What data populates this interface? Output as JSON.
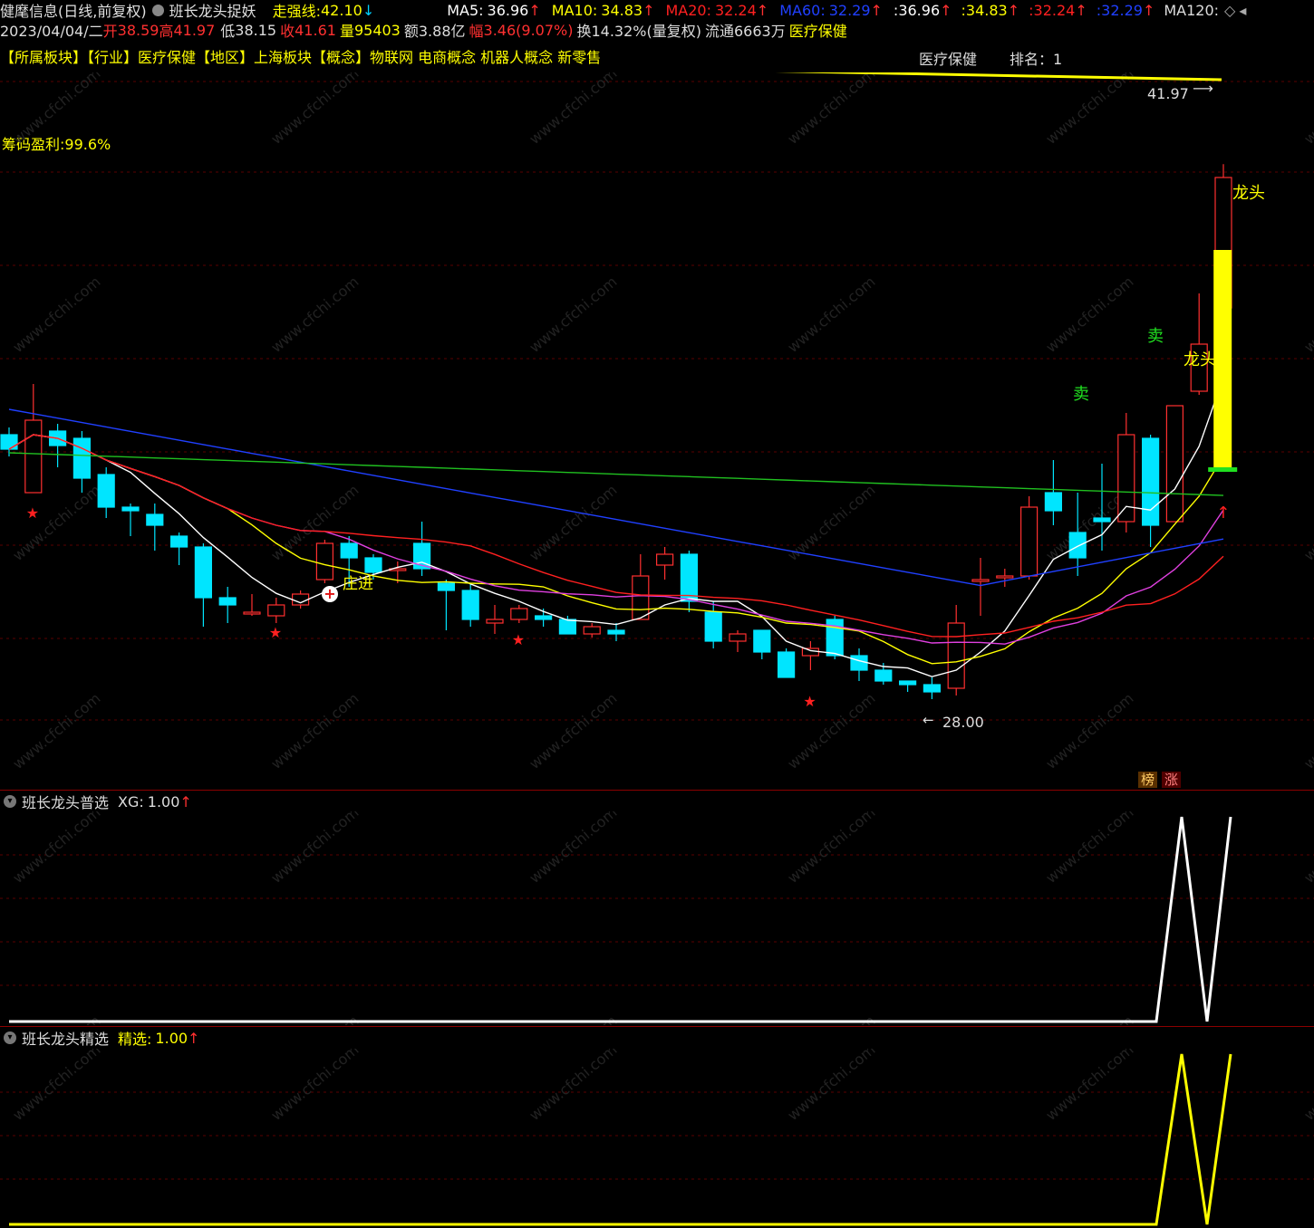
{
  "header": {
    "app_name": "健麾信息(日线,前复权)",
    "formula_name": "班长龙头捉妖",
    "strong_line_label": "走强线:",
    "strong_line_value": "42.10",
    "ma5_label": "MA5:",
    "ma5_value": "36.96",
    "ma10_label": "MA10:",
    "ma10_value": "34.83",
    "ma20_label": "MA20:",
    "ma20_value": "32.24",
    "ma60_label": "MA60:",
    "ma60_value": "32.29",
    "ma_repeat_1": ":36.96",
    "ma_repeat_2": ":34.83",
    "ma_repeat_3": ":32.24",
    "ma_repeat_4": ":32.29",
    "ma120_label": "MA120:",
    "colors": {
      "ma5": "#ffffff",
      "ma10": "#ffff00",
      "ma20": "#ff2020",
      "ma60": "#2040ff",
      "ma120": "#20c020"
    }
  },
  "quote": {
    "date": "2023/04/04/二",
    "open_label": "开",
    "open": "38.59",
    "high_label": "高",
    "high": "41.97",
    "low_label": "低",
    "low": "38.15",
    "close_label": "收",
    "close": "41.61",
    "volume_label": "量",
    "volume": "95403",
    "amount_label": "额",
    "amount": "3.88亿",
    "change_label": "幅",
    "change": "3.46(9.07%)",
    "turnover": "换14.32%(量复权)",
    "float": "流通6663万",
    "sector": "医疗保健"
  },
  "tags": {
    "line": "【所属板块】【行业】医疗保健【地区】上海板块【概念】物联网 电商概念 机器人概念 新零售",
    "industry": "医疗保健",
    "rank": "排名：1"
  },
  "annotations": {
    "chip_profit": "筹码盈利:99.6%",
    "max_price": "41.97",
    "min_price": "28.00",
    "dragon_head_1": "龙头",
    "dragon_head_2": "龙头",
    "sell_1": "卖",
    "sell_2": "卖",
    "banker_in": "庄进",
    "badge_list": "榜",
    "badge_rise": "涨"
  },
  "panel2": {
    "title": "班长龙头普选",
    "label": "XG:",
    "value": "1.00"
  },
  "panel3": {
    "title": "班长龙头精选",
    "label": "精选:",
    "value": "1.00"
  },
  "chart_data": [
    {
      "type": "candlestick",
      "title": "健麾信息(日线,前复权)",
      "ylim": [
        26.5,
        44
      ],
      "candles": [
        [
          34.5,
          34.1,
          34.7,
          33.9
        ],
        [
          32.9,
          34.9,
          35.9,
          32.9
        ],
        [
          34.6,
          34.2,
          34.8,
          33.6
        ],
        [
          34.4,
          33.3,
          34.6,
          32.9
        ],
        [
          33.4,
          32.5,
          33.6,
          32.2
        ],
        [
          32.5,
          32.4,
          32.6,
          31.7
        ],
        [
          32.3,
          32.0,
          32.6,
          31.3
        ],
        [
          31.7,
          31.4,
          31.8,
          30.9
        ],
        [
          31.4,
          30.0,
          31.5,
          29.2
        ],
        [
          30.0,
          29.8,
          30.3,
          29.3
        ],
        [
          29.6,
          29.6,
          30.1,
          29.5
        ],
        [
          29.5,
          29.8,
          30.0,
          29.3
        ],
        [
          29.8,
          30.1,
          30.2,
          29.7
        ],
        [
          30.5,
          31.5,
          31.6,
          30.4
        ],
        [
          31.5,
          31.1,
          31.7,
          30.3
        ],
        [
          31.1,
          30.7,
          31.2,
          30.5
        ],
        [
          30.8,
          30.8,
          31.0,
          30.4
        ],
        [
          31.5,
          30.8,
          32.1,
          30.6
        ],
        [
          30.4,
          30.2,
          30.5,
          29.1
        ],
        [
          30.2,
          29.4,
          30.4,
          29.2
        ],
        [
          29.3,
          29.4,
          29.8,
          29.0
        ],
        [
          29.4,
          29.7,
          29.8,
          29.3
        ],
        [
          29.5,
          29.4,
          29.7,
          29.2
        ],
        [
          29.4,
          29.0,
          29.5,
          29.0
        ],
        [
          29.0,
          29.2,
          29.3,
          28.9
        ],
        [
          29.1,
          29.0,
          29.3,
          28.8
        ],
        [
          29.4,
          30.6,
          31.2,
          29.4
        ],
        [
          30.9,
          31.2,
          31.4,
          30.5
        ],
        [
          31.2,
          29.9,
          31.3,
          29.6
        ],
        [
          29.6,
          28.8,
          29.9,
          28.6
        ],
        [
          28.8,
          29.0,
          29.1,
          28.5
        ],
        [
          29.1,
          28.5,
          29.1,
          28.3
        ],
        [
          28.5,
          27.8,
          28.6,
          27.8
        ],
        [
          28.4,
          28.6,
          28.8,
          28.0
        ],
        [
          29.4,
          28.4,
          29.5,
          28.3
        ],
        [
          28.4,
          28.0,
          28.6,
          27.7
        ],
        [
          28.0,
          27.7,
          28.2,
          27.6
        ],
        [
          27.7,
          27.6,
          27.7,
          27.4
        ],
        [
          27.6,
          27.4,
          27.8,
          27.2
        ],
        [
          27.5,
          29.3,
          29.8,
          27.3
        ],
        [
          30.5,
          30.5,
          31.1,
          29.5
        ],
        [
          30.6,
          30.6,
          30.8,
          30.3
        ],
        [
          30.6,
          32.5,
          32.8,
          30.5
        ],
        [
          32.9,
          32.4,
          33.8,
          32.0
        ],
        [
          31.8,
          31.1,
          32.9,
          30.6
        ],
        [
          32.2,
          32.1,
          33.7,
          31.3
        ],
        [
          32.1,
          34.5,
          35.1,
          31.8
        ],
        [
          34.4,
          32.0,
          34.5,
          31.4
        ],
        [
          32.1,
          35.3,
          35.3,
          32.6
        ],
        [
          35.7,
          37.0,
          38.4,
          35.6
        ],
        [
          38.0,
          41.6,
          41.97,
          38.2
        ]
      ]
    },
    {
      "type": "line",
      "name": "XG",
      "ylim": [
        0,
        1
      ],
      "values_tail": [
        0,
        1,
        0,
        1
      ]
    },
    {
      "type": "line",
      "name": "精选",
      "ylim": [
        0,
        1
      ],
      "values_tail": [
        0,
        1,
        0,
        1
      ]
    }
  ]
}
